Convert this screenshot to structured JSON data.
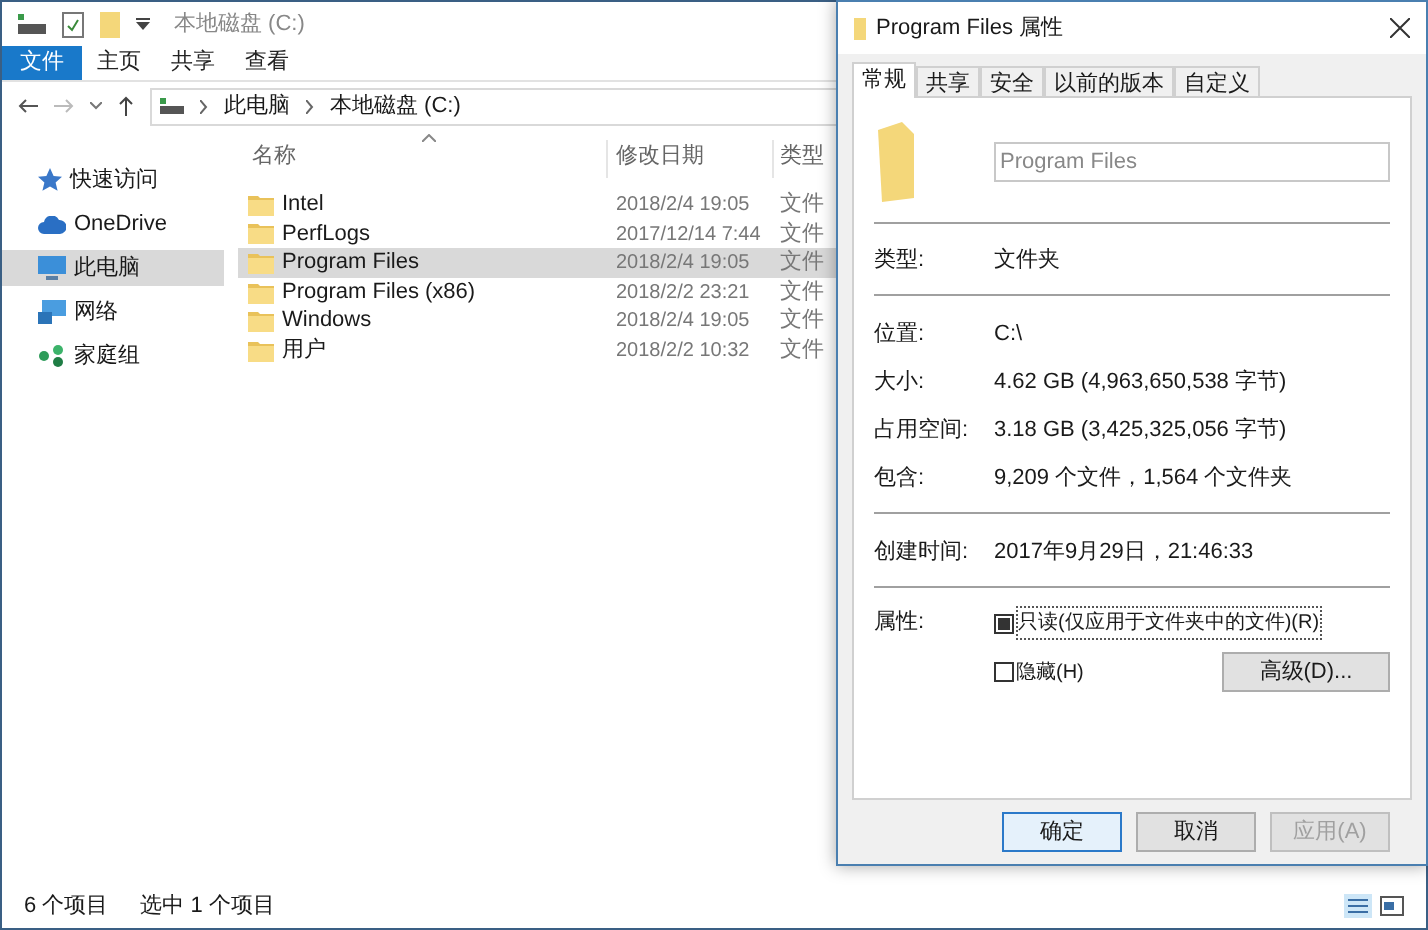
{
  "explorer": {
    "title": "本地磁盘 (C:)",
    "ribbon_tabs": [
      {
        "label": "文件",
        "selected": true
      },
      {
        "label": "主页",
        "selected": false
      },
      {
        "label": "共享",
        "selected": false
      },
      {
        "label": "查看",
        "selected": false
      }
    ],
    "breadcrumb": [
      "此电脑",
      "本地磁盘 (C:)"
    ],
    "sidebar": {
      "items": [
        {
          "label": "快速访问",
          "kind": "star",
          "selected": false
        },
        {
          "label": "OneDrive",
          "kind": "cloud",
          "selected": false
        },
        {
          "label": "此电脑",
          "kind": "pc",
          "selected": true
        },
        {
          "label": "网络",
          "kind": "network",
          "selected": false
        },
        {
          "label": "家庭组",
          "kind": "homegroup",
          "selected": false
        }
      ]
    },
    "table": {
      "columns": [
        "名称",
        "修改日期",
        "类型"
      ],
      "rows": [
        {
          "name": "Intel",
          "date": "2018/2/4 19:05",
          "type": "文件",
          "selected": false
        },
        {
          "name": "PerfLogs",
          "date": "2017/12/14 7:44",
          "type": "文件",
          "selected": false
        },
        {
          "name": "Program Files",
          "date": "2018/2/4 19:05",
          "type": "文件",
          "selected": true
        },
        {
          "name": "Program Files (x86)",
          "date": "2018/2/2 23:21",
          "type": "文件",
          "selected": false
        },
        {
          "name": "Windows",
          "date": "2018/2/4 19:05",
          "type": "文件",
          "selected": false
        },
        {
          "name": "用户",
          "date": "2018/2/2 10:32",
          "type": "文件",
          "selected": false
        }
      ]
    },
    "status_bar": [
      "6 个项目",
      "选中 1 个项目"
    ]
  },
  "dialog": {
    "title": "Program Files 属性",
    "tabs": [
      {
        "label": "常规",
        "selected": true
      },
      {
        "label": "共享",
        "selected": false
      },
      {
        "label": "安全",
        "selected": false
      },
      {
        "label": "以前的版本",
        "selected": false
      },
      {
        "label": "自定义",
        "selected": false
      }
    ],
    "name_field": {
      "placeholder": "Program Files"
    },
    "sections": [
      [
        {
          "label": "类型:",
          "value": "文件夹"
        }
      ],
      [
        {
          "label": "位置:",
          "value": "C:\\"
        },
        {
          "label": "大小:",
          "value": "4.62 GB (4,963,650,538 字节)"
        },
        {
          "label": "占用空间:",
          "value": "3.18 GB (3,425,325,056 字节)"
        },
        {
          "label": "包含:",
          "value": "9,209 个文件，1,564 个文件夹"
        }
      ],
      [
        {
          "label": "创建时间:",
          "value": "2017年9月29日，21:46:33"
        }
      ]
    ],
    "attributes": {
      "label": "属性:",
      "options": [
        {
          "label": "只读(仅应用于文件夹中的文件)(R)",
          "indeterminate": true
        },
        {
          "label": "隐藏(H)",
          "checked": false
        }
      ],
      "advanced_button": "高级(D)..."
    },
    "buttons": [
      {
        "label": "确定",
        "default": true,
        "disabled": false
      },
      {
        "label": "取消",
        "default": false,
        "disabled": false
      },
      {
        "label": "应用(A)",
        "default": false,
        "disabled": true
      }
    ]
  }
}
